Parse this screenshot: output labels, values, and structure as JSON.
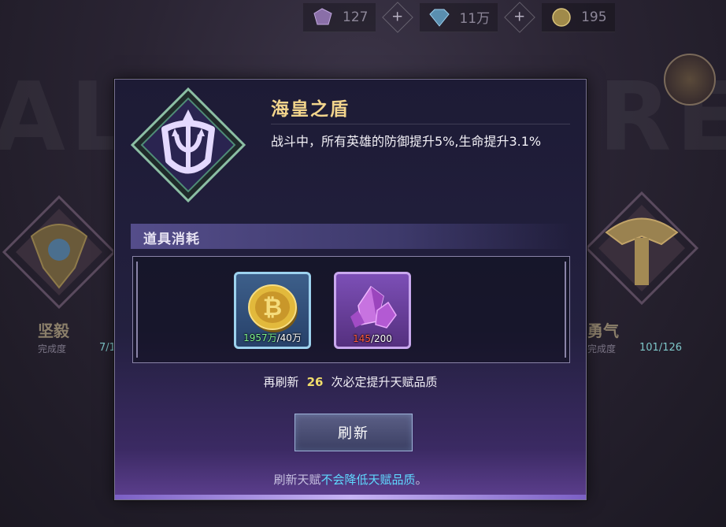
{
  "background": {
    "left_title": "坚毅",
    "left_label": "完成度",
    "left_progress": "7/1",
    "right_title": "勇气",
    "right_label": "完成度",
    "right_progress": "101/126"
  },
  "topbar": {
    "resources": [
      {
        "icon": "crystal-icon",
        "value": "127"
      },
      {
        "icon": "diamond-icon",
        "value": "11万"
      },
      {
        "icon": "coin-icon",
        "value": "195"
      }
    ]
  },
  "modal": {
    "talent_name": "海皇之盾",
    "talent_description": "战斗中，所有英雄的防御提升5%,生命提升3.1%",
    "talent_icon": "trident-shield-icon",
    "cost_section_title": "道具消耗",
    "items": [
      {
        "icon": "coin-icon",
        "have": "1957万",
        "need": "/40万",
        "status": "ok"
      },
      {
        "icon": "purple-crystal-icon",
        "have": "145",
        "need": "/200",
        "status": "insufficient"
      }
    ],
    "refresh_note_prefix": "再刷新",
    "refresh_note_count": "26",
    "refresh_note_suffix": "次必定提升天赋品质",
    "refresh_button": "刷新",
    "footer_prefix": "刷新天赋",
    "footer_highlight": "不会降低天赋品质",
    "footer_suffix": "。"
  },
  "colors": {
    "accent_gold": "#f3d58c",
    "highlight_cyan": "#5fd9ff",
    "ok_green": "#7ff28b",
    "warn_red": "#ff5a3c"
  }
}
